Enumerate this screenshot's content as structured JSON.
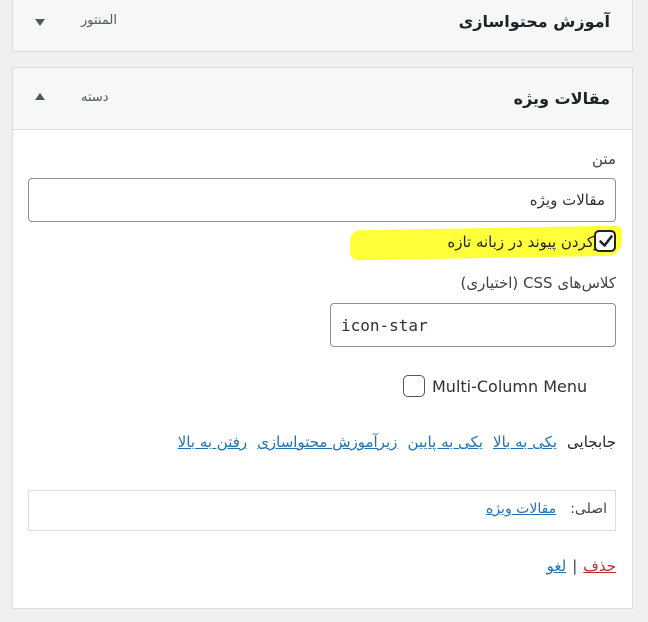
{
  "top_item": {
    "title": "آموزش محتواسازی",
    "type": "المنتور"
  },
  "main_item": {
    "title": "مقالات ویژه",
    "type": "دسته"
  },
  "fields": {
    "nav_label_label": "متن",
    "nav_label_value": "مقالات ویژه",
    "new_tab_label": "بازکردن پیوند در زبانه تازه",
    "css_classes_label": "کلاس‌های CSS (اختیاری)",
    "css_classes_value": "icon-star",
    "multi_column_label": "Multi-Column Menu"
  },
  "move": {
    "label": "جابجایی",
    "links": [
      "یکی به بالا",
      "یکی به پایین",
      "زیرآموزش محتواسازی",
      "رفتن به بالا"
    ]
  },
  "original": {
    "label": "اصلی:",
    "link": "مقالات ویژه"
  },
  "actions": {
    "remove": "حذف",
    "separator": "|",
    "cancel": "لغو"
  },
  "colors": {
    "link": "#2271b1",
    "delete": "#b32d2e",
    "highlight": "#ffff3a"
  }
}
